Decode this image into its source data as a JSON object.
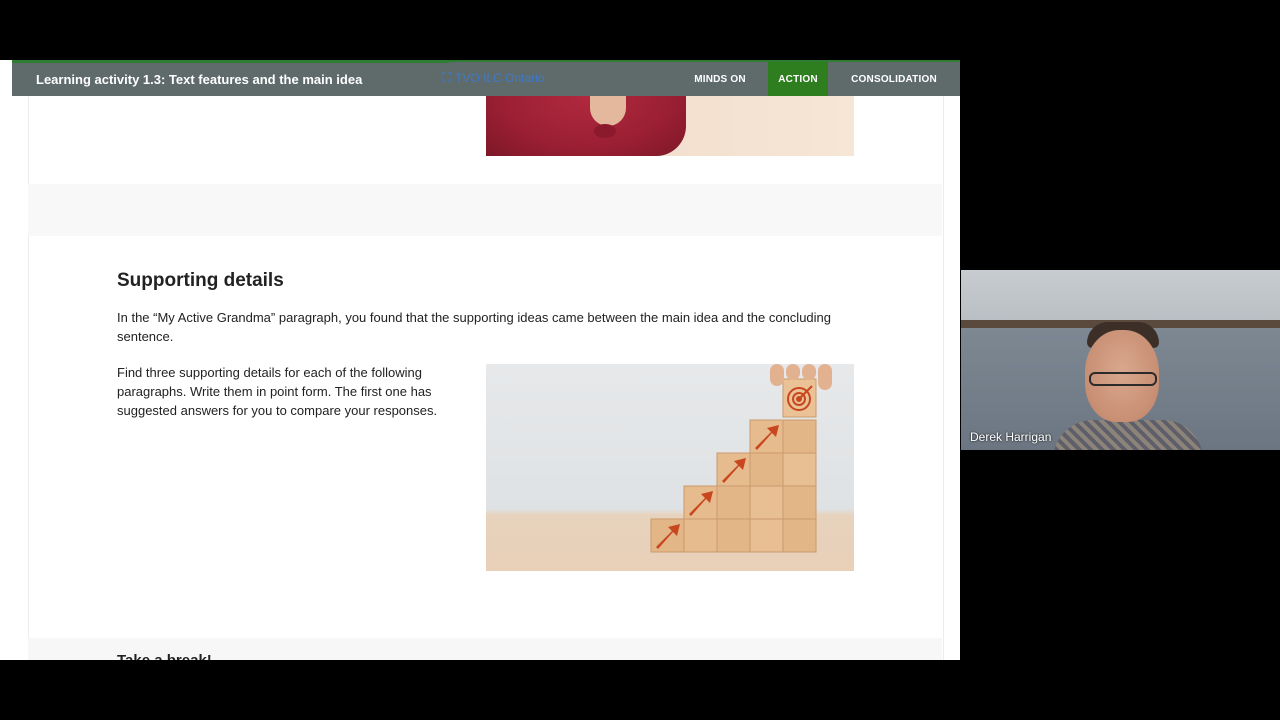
{
  "header": {
    "title": "Learning activity 1.3: Text features and the main idea",
    "watermark": "TVO ILC Ontario",
    "nav": [
      {
        "label": "MINDS ON",
        "active": false
      },
      {
        "label": "ACTION",
        "active": true
      },
      {
        "label": "CONSOLIDATION",
        "active": false
      }
    ]
  },
  "content": {
    "heading": "Supporting details",
    "paragraph1": "In the “My Active Grandma” paragraph, you found that the supporting ideas came between the main idea and the concluding sentence.",
    "paragraph2": "Find three supporting details for each of the following paragraphs. Write them in point form. The first one has suggested answers for you to compare your responses.",
    "next_heading": "Take a break!"
  },
  "webcam": {
    "participant_name": "Derek Harrigan"
  },
  "colors": {
    "header_bg": "#5f6b6b",
    "accent_green": "#2e7d1f",
    "arrow_orange": "#c8471f"
  },
  "icons": {
    "watermark": "tvo-logo-icon",
    "target": "target-icon",
    "arrow": "arrow-up-right-icon"
  }
}
